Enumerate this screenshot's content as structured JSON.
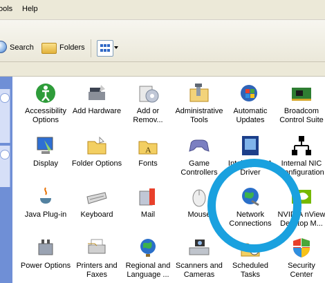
{
  "menu": {
    "tools_partial": "ools",
    "help": "Help"
  },
  "toolbar": {
    "search_label": "Search",
    "folders_label": "Folders"
  },
  "items": {
    "accessibility": "Accessibility\nOptions",
    "add_hardware": "Add Hardware",
    "add_remove": "Add or\nRemov...",
    "admin_tools": "Administrative\nTools",
    "auto_updates": "Automatic\nUpdates",
    "broadcom": "Broadcom\nControl Suite",
    "display": "Display",
    "folder_options": "Folder Options",
    "fonts": "Fonts",
    "game_controllers": "Game\nControllers",
    "intel_pma": "Intel(R) GMA\nDriver",
    "internal_nic": "Internal NIC\nConfiguration",
    "java": "Java Plug-in",
    "keyboard": "Keyboard",
    "mail": "Mail",
    "mouse": "Mouse",
    "network": "Network\nConnections",
    "nvidia": "NVIDIA nView\nDesktop M...",
    "power": "Power Options",
    "printers": "Printers and\nFaxes",
    "regional": "Regional and\nLanguage ...",
    "scanners": "Scanners and\nCameras",
    "scheduled": "Scheduled\nTasks",
    "security": "Security\nCenter"
  },
  "colors": {
    "highlight_ring": "#1aa1df",
    "xp_blue": "#3169c6"
  }
}
